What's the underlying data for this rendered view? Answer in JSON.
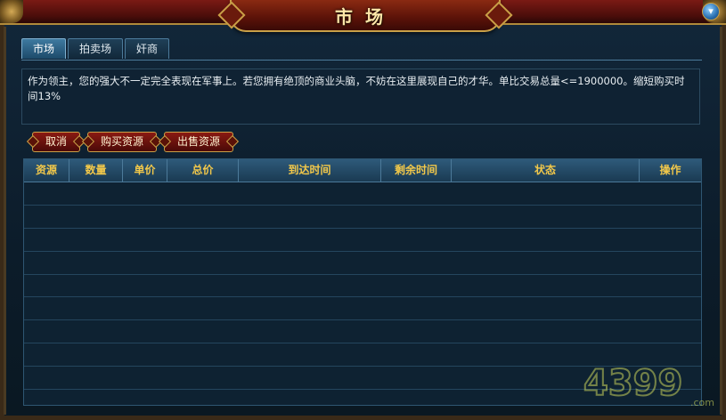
{
  "window": {
    "title": "市场",
    "help_icon": "help-icon"
  },
  "tabs": [
    {
      "label": "市场",
      "active": true
    },
    {
      "label": "拍卖场",
      "active": false
    },
    {
      "label": "奸商",
      "active": false
    }
  ],
  "description": "作为领主，您的强大不一定完全表现在军事上。若您拥有绝顶的商业头脑，不妨在这里展现自己的才华。单比交易总量<=1900000。缩短购买时间13%",
  "actions": {
    "cancel": "取消",
    "buy": "购买资源",
    "sell": "出售资源"
  },
  "table": {
    "columns": [
      "资源",
      "数量",
      "单价",
      "总价",
      "到达时间",
      "剩余时间",
      "状态",
      "操作"
    ],
    "rows": []
  },
  "watermark": {
    "text": "4399",
    "suffix": ".com"
  },
  "colors": {
    "header_text": "#f2c84a",
    "accent_red": "#7a1a14",
    "gold": "#c9a047"
  }
}
